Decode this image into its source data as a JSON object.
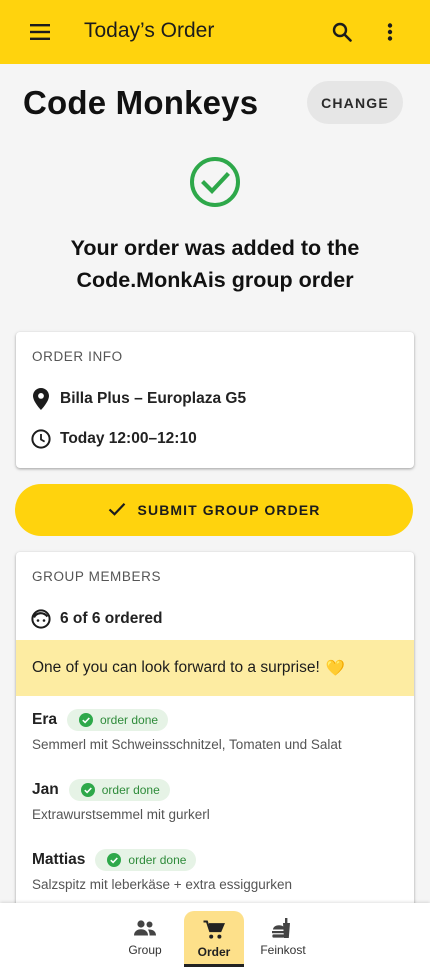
{
  "appbar": {
    "title": "Today’s Order",
    "menu_icon": "menu-icon",
    "search_icon": "search-icon",
    "more_icon": "more-vert-icon",
    "color": "#ffd30d"
  },
  "group": {
    "name": "Code Monkeys",
    "change_label": "CHANGE"
  },
  "success": {
    "icon": "check-circle-icon",
    "color": "#2ea84a",
    "message": "Your order was added to the Code.MonkAis group order"
  },
  "order_info": {
    "header": "ORDER INFO",
    "location": "Billa Plus – Europlaza G5",
    "location_icon": "location-pin-icon",
    "time": "Today 12:00–12:10",
    "time_icon": "clock-icon"
  },
  "submit": {
    "label": "SUBMIT GROUP ORDER",
    "icon": "check-icon"
  },
  "members": {
    "header": "GROUP MEMBERS",
    "count_text": "6 of 6 ordered",
    "count_icon": "face-icon",
    "surprise_text": "One of you can look forward to a surprise!",
    "surprise_emoji": "💛",
    "list": [
      {
        "name": "Era",
        "status": "order done",
        "order": "Semmerl mit Schweinsschnitzel, Tomaten und Salat"
      },
      {
        "name": "Jan",
        "status": "order done",
        "order": "Extrawurstsemmel mit gurkerl"
      },
      {
        "name": "Mattias",
        "status": "order done",
        "order": "Salzspitz mit leberkäse + extra essiggurken"
      }
    ]
  },
  "bottom_nav": {
    "items": [
      {
        "label": "Group",
        "icon": "group-icon",
        "active": false
      },
      {
        "label": "Order",
        "icon": "cart-icon",
        "active": true
      },
      {
        "label": "Feinkost",
        "icon": "food-icon",
        "active": false
      }
    ]
  }
}
